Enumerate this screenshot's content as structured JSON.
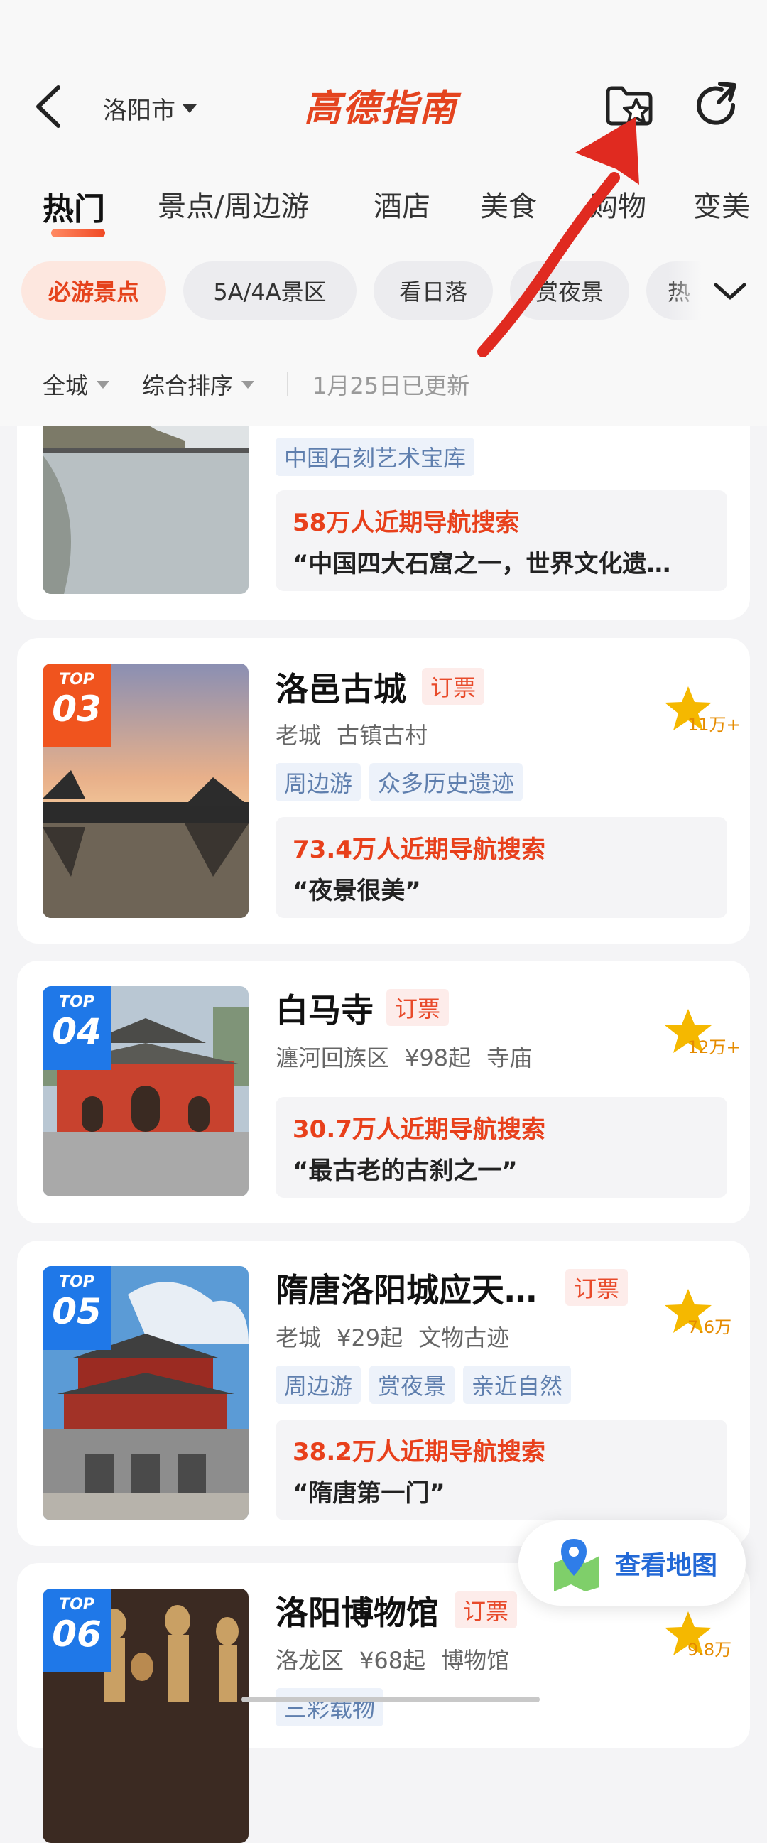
{
  "header": {
    "city": "洛阳市",
    "logo": "高德指南"
  },
  "tabs": [
    "热门",
    "景点/周边游",
    "酒店",
    "美食",
    "购物",
    "变美"
  ],
  "chips": [
    "必游景点",
    "5A/4A景区",
    "看日落",
    "赏夜景",
    "热"
  ],
  "filters": {
    "scope": "全城",
    "sort": "综合排序",
    "updated": "1月25日已更新"
  },
  "partial_card": {
    "tag": "中国石刻艺术宝库",
    "search_count": "58万人近期导航搜索",
    "quote": "“中国四大石窟之一，世界文化遗…"
  },
  "cards": [
    {
      "top_label": "TOP",
      "rank": "03",
      "title": "洛邑古城",
      "ticket": "订票",
      "meta": [
        "老城",
        "古镇古村"
      ],
      "tags": [
        "周边游",
        "众多历史遗迹"
      ],
      "search_count": "73.4万人近期导航搜索",
      "quote": "“夜景很美”",
      "rating": "11万+"
    },
    {
      "top_label": "TOP",
      "rank": "04",
      "title": "白马寺",
      "ticket": "订票",
      "meta": [
        "瀍河回族区",
        "¥98起",
        "寺庙"
      ],
      "tags": [],
      "search_count": "30.7万人近期导航搜索",
      "quote": "“最古老的古刹之一”",
      "rating": "12万+"
    },
    {
      "top_label": "TOP",
      "rank": "05",
      "title": "隋唐洛阳城应天…",
      "ticket": "订票",
      "meta": [
        "老城",
        "¥29起",
        "文物古迹"
      ],
      "tags": [
        "周边游",
        "赏夜景",
        "亲近自然"
      ],
      "search_count": "38.2万人近期导航搜索",
      "quote": "“隋唐第一门”",
      "rating": "7.6万"
    },
    {
      "top_label": "TOP",
      "rank": "06",
      "title": "洛阳博物馆",
      "ticket": "订票",
      "meta": [
        "洛龙区",
        "¥68起",
        "博物馆"
      ],
      "tags": [
        "三彩载物"
      ],
      "rating": "9.8万"
    }
  ],
  "map_button": "查看地图",
  "colors": {
    "accent": "#e8401b",
    "top_orange": "#f0541e",
    "top_blue": "#1f78e8",
    "tag_text": "#5f7fae",
    "star": "#f5b800",
    "map_text": "#2369d6"
  },
  "icons": [
    "back-arrow-icon",
    "chevron-down-icon",
    "folder-star-icon",
    "share-icon",
    "star-icon",
    "map-pin-icon"
  ]
}
